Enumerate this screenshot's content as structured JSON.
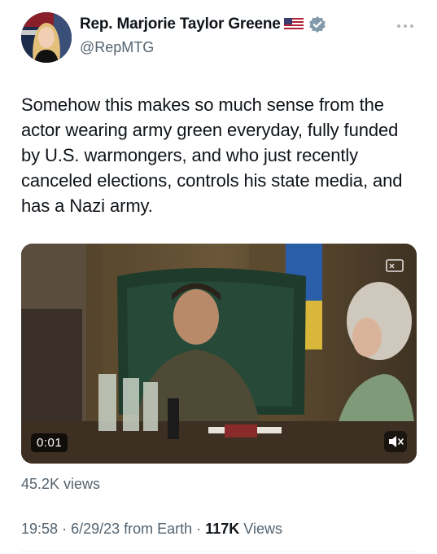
{
  "author": {
    "display_name": "Rep. Marjorie Taylor Greene",
    "flag_emoji": "🇺🇸",
    "handle": "@RepMTG",
    "verified_badge_color": "#829aab"
  },
  "tweet": {
    "text": "Somehow this makes so much sense from the actor wearing army green everyday, fully funded by U.S. warmongers, and who just recently canceled elections, controls his state media, and has a Nazi army."
  },
  "video": {
    "timestamp": "0:01"
  },
  "stats": {
    "views_label": "45.2K views",
    "time": "19:58",
    "date": "6/29/23",
    "source": "from Earth",
    "separator": "·",
    "view_count": "117K",
    "view_word": "Views"
  },
  "icons": [
    "verified-badge-icon",
    "more-options-icon",
    "mute-icon",
    "picture-in-picture-icon"
  ]
}
